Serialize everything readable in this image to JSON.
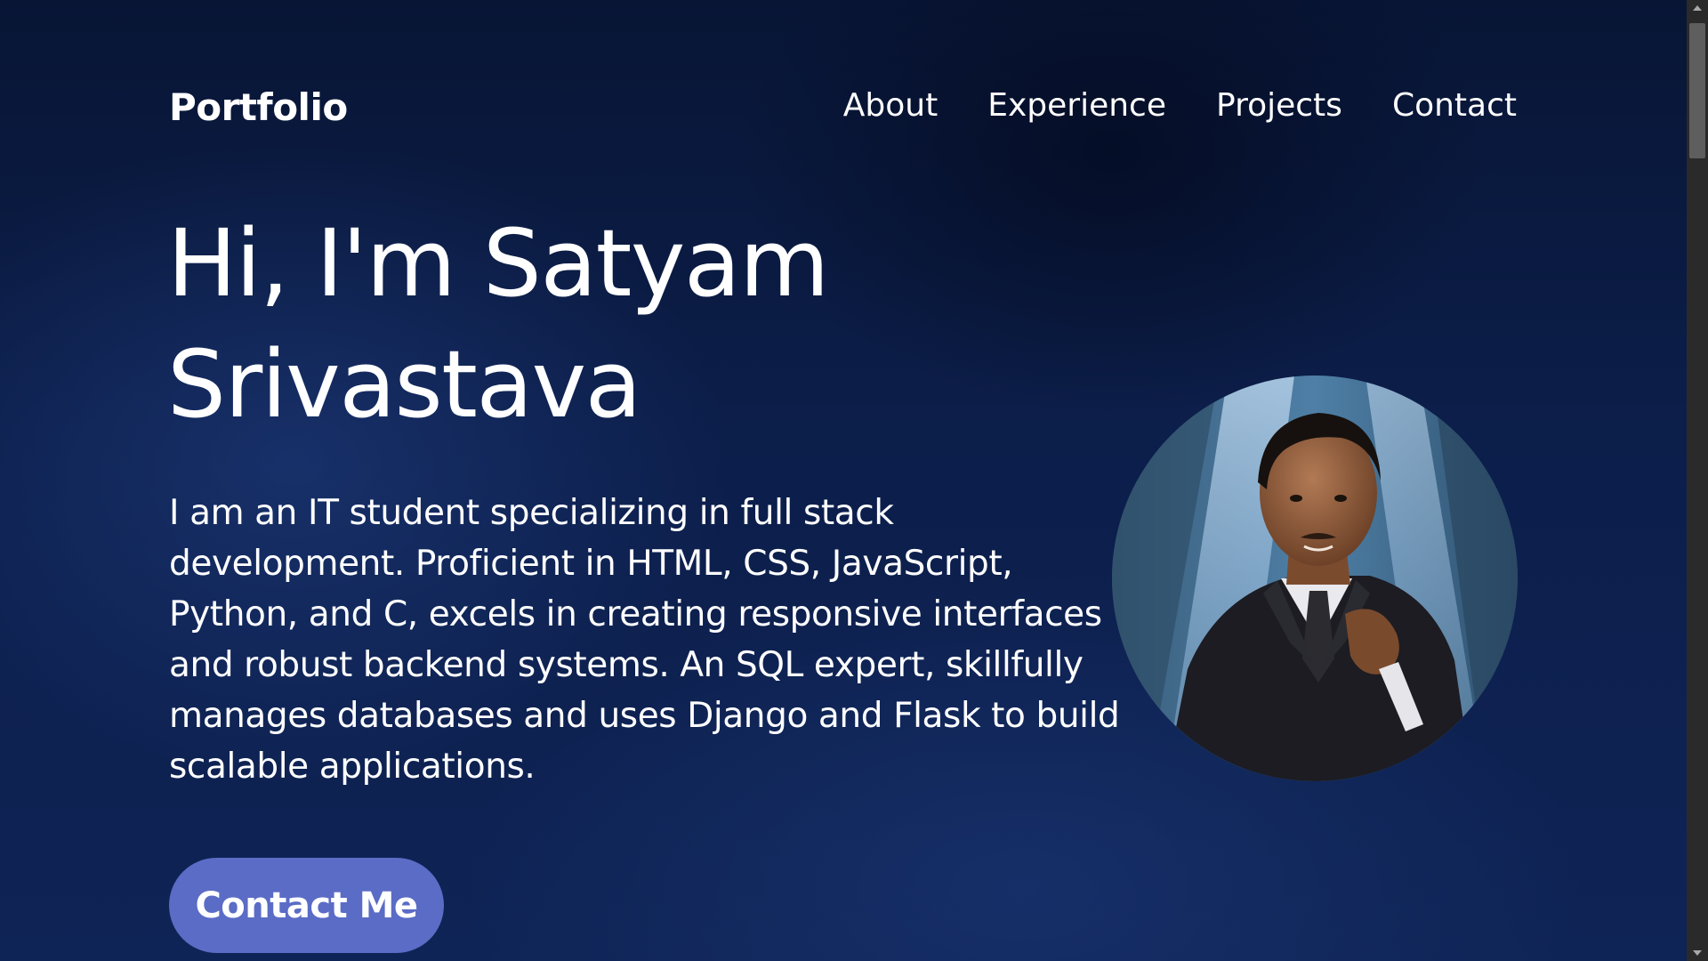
{
  "header": {
    "logo": "Portfolio",
    "nav": [
      {
        "label": "About"
      },
      {
        "label": "Experience"
      },
      {
        "label": "Projects"
      },
      {
        "label": "Contact"
      }
    ]
  },
  "hero": {
    "title_line1": "Hi, I'm Satyam",
    "title_line2": "Srivastava",
    "description": "I am an IT student specializing in full stack development. Proficient in HTML, CSS, JavaScript, Python, and C, excels in creating responsive interfaces and robust backend systems. An SQL expert, skillfully manages databases and uses Django and Flask to build scalable applications.",
    "cta_label": "Contact Me"
  },
  "colors": {
    "background": "#0c1e4a",
    "accent_button": "#5b6cc6",
    "text": "#ffffff"
  },
  "icons": {
    "scroll_up": "triangle-up-icon",
    "scroll_down": "triangle-down-icon"
  }
}
